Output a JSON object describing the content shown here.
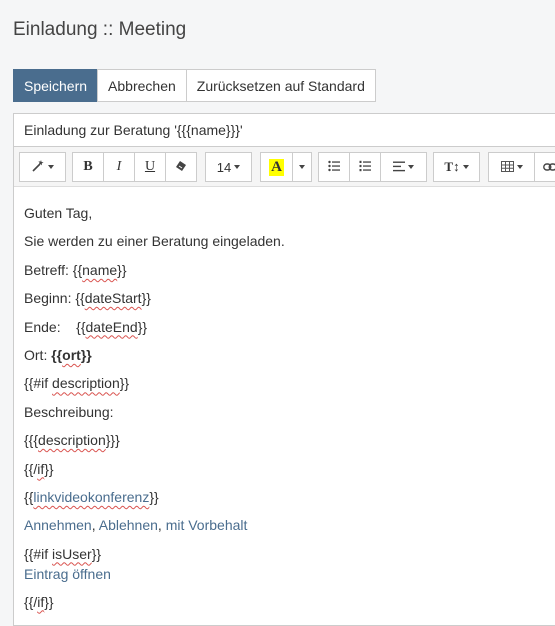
{
  "page": {
    "title": "Einladung :: Meeting"
  },
  "actions": {
    "save": "Speichern",
    "cancel": "Abbrechen",
    "reset": "Zurücksetzen auf Standard"
  },
  "subject": {
    "value": "Einladung zur Beratung '{{{name}}}'"
  },
  "toolbar": {
    "font_size": "14",
    "icons": [
      "magic-wand-icon",
      "bold-icon",
      "italic-icon",
      "underline-icon",
      "eraser-icon",
      "font-color-icon",
      "unordered-list-icon",
      "ordered-list-icon",
      "align-icon",
      "text-height-icon",
      "table-icon",
      "link-icon"
    ],
    "bold_glyph": "B",
    "italic_glyph": "I",
    "underline_glyph": "U",
    "color_glyph": "A",
    "text_height_glyph": "T↕",
    "highlight_color": "#ffff00"
  },
  "body": {
    "greeting": "Guten Tag,",
    "intro": "Sie werden zu einer Beratung eingeladen.",
    "betreff_label": "Betreff:",
    "betreff_value": "name",
    "beginn_label": "Beginn:",
    "beginn_value": "dateStart",
    "ende_label": "Ende:",
    "ende_value": "dateEnd",
    "ort_label": "Ort:",
    "ort_value": "ort",
    "if_description_open": "{{#if ",
    "if_description_word": "description",
    "if_description_close": "}}",
    "beschreibung_label": "Beschreibung:",
    "description_var": "description",
    "endif_1": "if",
    "linkvideo_var": "linkvideokonferenz",
    "accept": "Annehmen",
    "decline": "Ablehnen",
    "tentative": "mit Vorbehalt",
    "if_user_open": "{{#if ",
    "if_user_word": "isUser",
    "if_user_close": "}}",
    "open_entry": "Eintrag öffnen",
    "endif_2": "if"
  },
  "colors": {
    "primary": "#4a6d8e",
    "link": "#4a6d8e"
  }
}
